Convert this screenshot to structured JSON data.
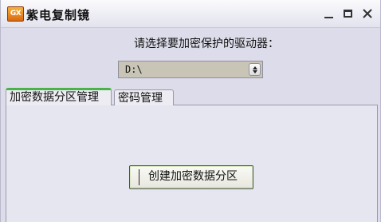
{
  "window": {
    "app_icon_text": "GX",
    "title": "紫电复制镜"
  },
  "titlebar_buttons": {
    "close_glyph": "✕"
  },
  "main": {
    "prompt": "请选择要加密保护的驱动器：",
    "drive_select": {
      "selected": "D:\\"
    },
    "tabs": [
      {
        "label": "加密数据分区管理",
        "active": true
      },
      {
        "label": "密码管理",
        "active": false
      }
    ],
    "create_button_label": "创建加密数据分区"
  },
  "colors": {
    "window_bg": "#dcdcea",
    "active_tab_accent": "#46b446",
    "select_bg": "#c8c4b6"
  }
}
